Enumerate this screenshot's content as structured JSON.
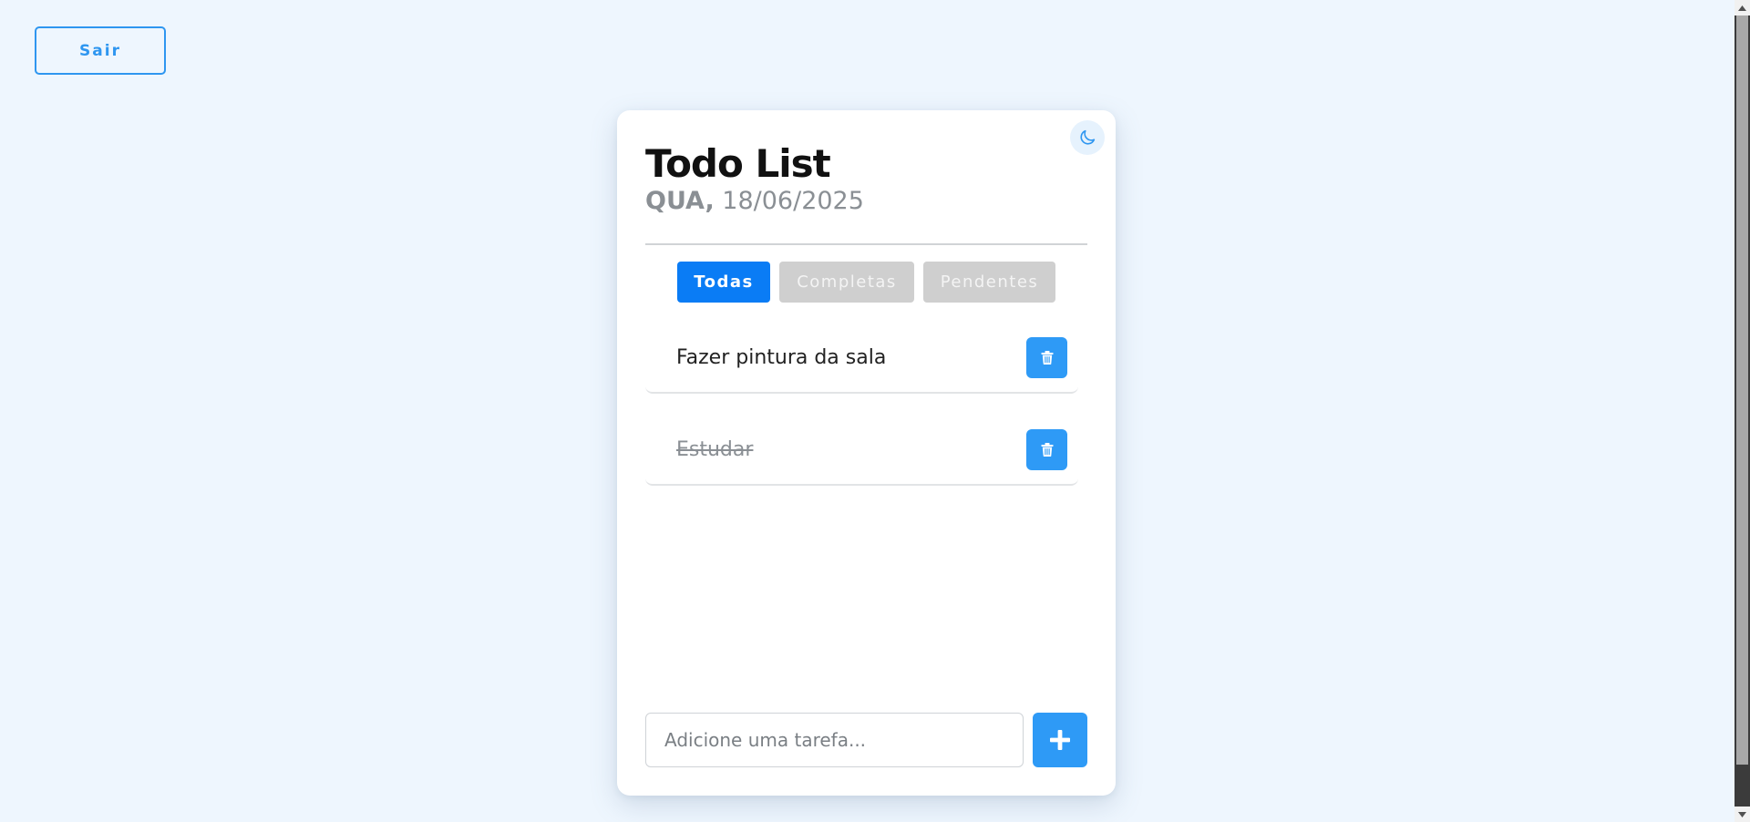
{
  "header_actions": {
    "logout_label": "Sair"
  },
  "card": {
    "title": "Todo List",
    "date": {
      "weekday": "QUA,",
      "value": "18/06/2025"
    },
    "theme_toggle_icon": "moon-icon",
    "filters": [
      {
        "label": "Todas",
        "active": true
      },
      {
        "label": "Completas",
        "active": false
      },
      {
        "label": "Pendentes",
        "active": false
      }
    ],
    "tasks": [
      {
        "text": "Fazer pintura da sala",
        "completed": false
      },
      {
        "text": "Estudar",
        "completed": true
      }
    ],
    "add": {
      "placeholder": "Adicione uma tarefa...",
      "button_icon": "plus-icon"
    }
  },
  "colors": {
    "background": "#eef6fe",
    "accent": "#2e9af6",
    "active_filter": "#0a7cf5",
    "inactive_filter": "#cfcfcf"
  }
}
